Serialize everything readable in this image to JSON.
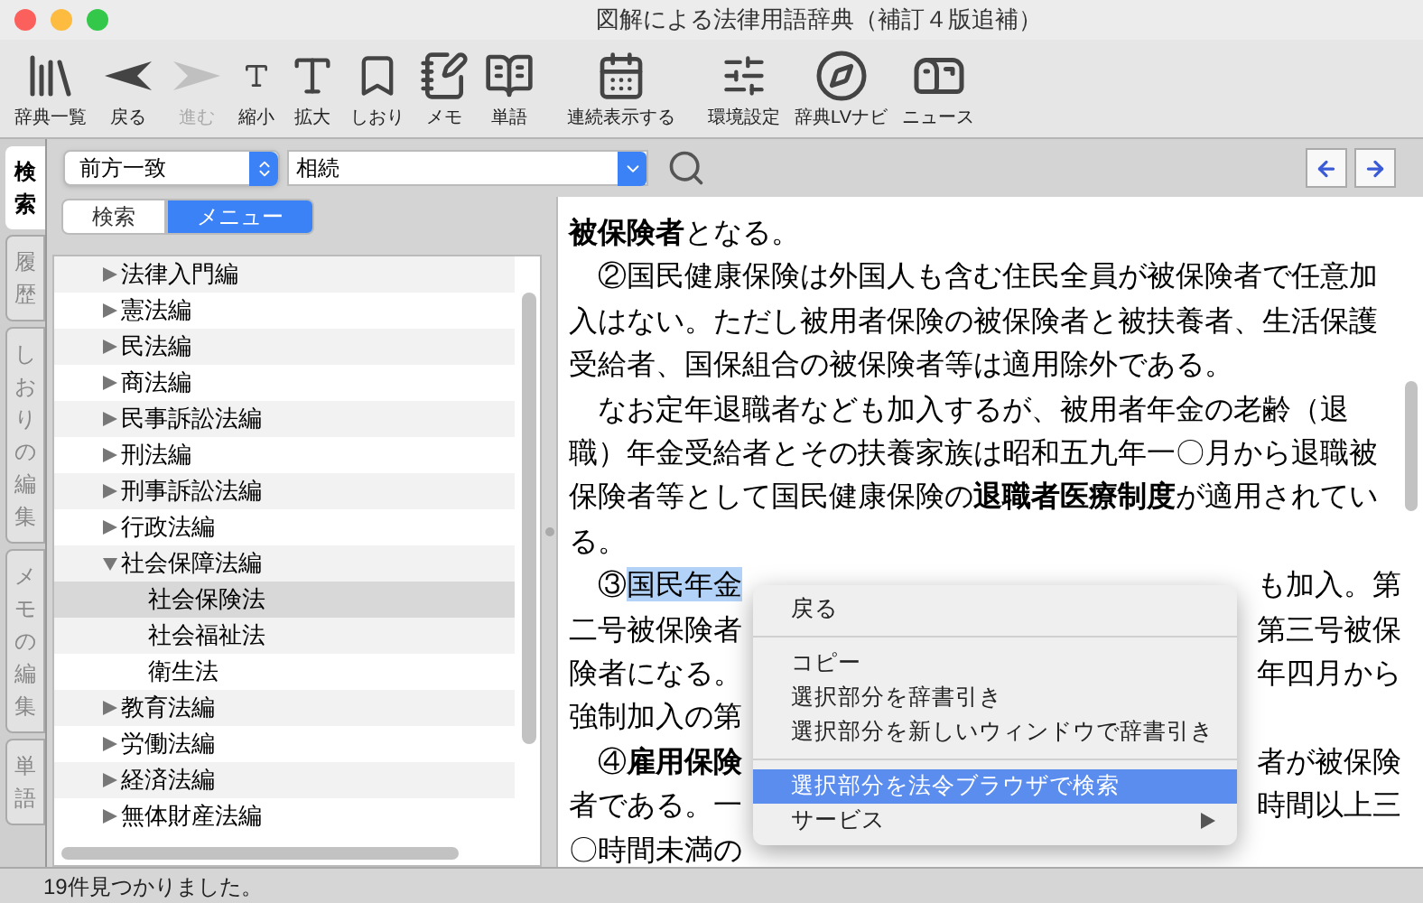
{
  "window": {
    "title": "図解による法律用語辞典（補訂４版追補）"
  },
  "toolbar": [
    {
      "kind": "dictionaries",
      "label": "辞典一覧",
      "disabled": false
    },
    {
      "kind": "back",
      "label": "戻る",
      "disabled": false
    },
    {
      "kind": "forward",
      "label": "進む",
      "disabled": true
    },
    {
      "kind": "smaller",
      "label": "縮小",
      "disabled": false
    },
    {
      "kind": "larger",
      "label": "拡大",
      "disabled": false
    },
    {
      "kind": "bookmark",
      "label": "しおり",
      "disabled": false
    },
    {
      "kind": "memo",
      "label": "メモ",
      "disabled": false
    },
    {
      "kind": "word",
      "label": "単語",
      "disabled": false
    },
    {
      "kind": "continuous",
      "label": "連続表示する",
      "disabled": false
    },
    {
      "kind": "settings",
      "label": "環境設定",
      "disabled": false
    },
    {
      "kind": "navi",
      "label": "辞典LVナビ",
      "disabled": false
    },
    {
      "kind": "news",
      "label": "ニュース",
      "disabled": false
    }
  ],
  "side_tabs": [
    {
      "label": "検索",
      "selected": true
    },
    {
      "label": "履歴",
      "selected": false
    },
    {
      "label": "しおりの編集",
      "selected": false
    },
    {
      "label": "メモの編集",
      "selected": false
    },
    {
      "label": "単語",
      "selected": false
    }
  ],
  "search": {
    "mode": "前方一致",
    "value": "相続"
  },
  "segments": [
    {
      "label": "検索",
      "selected": false
    },
    {
      "label": "メニュー",
      "selected": true
    }
  ],
  "tree": [
    {
      "label": "法律入門編",
      "expanded": false,
      "selected": false
    },
    {
      "label": "憲法編",
      "expanded": false,
      "selected": false
    },
    {
      "label": "民法編",
      "expanded": false,
      "selected": false
    },
    {
      "label": "商法編",
      "expanded": false,
      "selected": false
    },
    {
      "label": "民事訴訟法編",
      "expanded": false,
      "selected": false
    },
    {
      "label": "刑法編",
      "expanded": false,
      "selected": false
    },
    {
      "label": "刑事訴訟法編",
      "expanded": false,
      "selected": false
    },
    {
      "label": "行政法編",
      "expanded": false,
      "selected": false
    },
    {
      "label": "社会保障法編",
      "expanded": true,
      "selected": false,
      "children": [
        {
          "label": "社会保険法",
          "selected": true
        },
        {
          "label": "社会福祉法",
          "selected": false
        },
        {
          "label": "衛生法",
          "selected": false
        }
      ]
    },
    {
      "label": "教育法編",
      "expanded": false,
      "selected": false
    },
    {
      "label": "労働法編",
      "expanded": false,
      "selected": false
    },
    {
      "label": "経済法編",
      "expanded": false,
      "selected": false
    },
    {
      "label": "無体財産法編",
      "expanded": false,
      "selected": false
    }
  ],
  "article": [
    {
      "left": "**被保険者**となる。"
    },
    {
      "left": "　②国民健康保険は外国人も含む住民全員が被保険者で任意加"
    },
    {
      "left": "入はない。ただし被用者保険の被保険者と被扶養者、生活保護"
    },
    {
      "left": "受給者、国保組合の被保険者等は適用除外である。"
    },
    {
      "left": "　なお定年退職者なども加入するが、被用者年金の老齢（退"
    },
    {
      "left": "職）年金受給者とその扶養家族は昭和五九年一〇月から退職被"
    },
    {
      "left": "保険者等として国民健康保険の**退職者医療制度**が適用されてい"
    },
    {
      "left": "る。"
    },
    {
      "left": "　③",
      "selection": "国民年金",
      "right": "も加入。第"
    },
    {
      "left": "二号被保険者",
      "right": "第三号被保"
    },
    {
      "left": "険者になる。",
      "right": "年四月から"
    },
    {
      "left": "強制加入の第"
    },
    {
      "left": "　④**雇用保険**",
      "right": "者が被保険"
    },
    {
      "left": "者である。一",
      "right": "時間以上三"
    },
    {
      "left": "〇時間未満の"
    }
  ],
  "context_menu": [
    {
      "kind": "item",
      "label": "戻る",
      "selected": false
    },
    {
      "kind": "separator"
    },
    {
      "kind": "item",
      "label": "コピー",
      "selected": false
    },
    {
      "kind": "item",
      "label": "選択部分を辞書引き",
      "selected": false
    },
    {
      "kind": "item",
      "label": "選択部分を新しいウィンドウで辞書引き",
      "selected": false
    },
    {
      "kind": "separator"
    },
    {
      "kind": "item",
      "label": "選択部分を法令ブラウザで検索",
      "selected": true
    },
    {
      "kind": "submenu",
      "label": "サービス",
      "selected": false
    }
  ],
  "status_bar": "19件見つかりました。"
}
